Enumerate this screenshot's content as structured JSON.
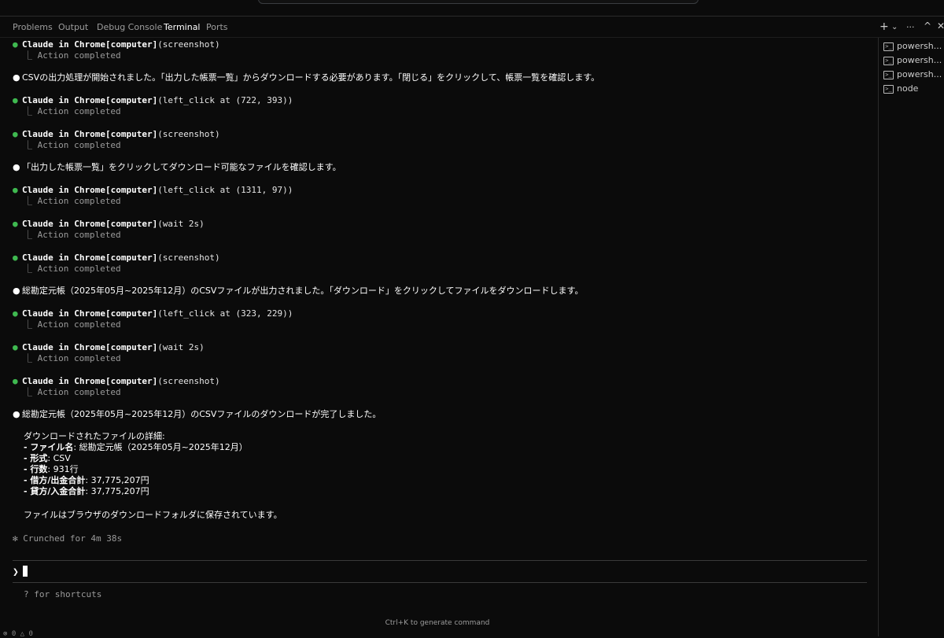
{
  "panel": {
    "tabs": [
      {
        "label": "Problems"
      },
      {
        "label": "Output"
      },
      {
        "label": "Debug Console"
      },
      {
        "label": "Terminal",
        "active": true
      },
      {
        "label": "Ports"
      }
    ],
    "actions": {
      "new": "+",
      "new_dropdown": "⌄",
      "more": "···",
      "maximize": "^",
      "close": "✕"
    }
  },
  "terminal_list": [
    {
      "label": "powersh...",
      "icon": "terminal-icon",
      "warning": "⚠"
    },
    {
      "label": "powersh...",
      "icon": "terminal-icon",
      "warning": "⚠"
    },
    {
      "label": "powersh...",
      "icon": "terminal-icon",
      "warning": "⚠"
    },
    {
      "label": "node",
      "icon": "terminal-icon"
    }
  ],
  "log": {
    "l1": {
      "cmd": "Claude in Chrome[computer]",
      "arg": "(screenshot)",
      "result": "⎿ Action completed"
    },
    "m1": "CSVの出力処理が開始されました。「出力した帳票一覧」からダウンロードする必要があります。「閉じる」をクリックして、帳票一覧を確認します。",
    "l2": {
      "cmd": "Claude in Chrome[computer]",
      "arg": "(left_click at (722, 393))",
      "result": "⎿ Action completed"
    },
    "l3": {
      "cmd": "Claude in Chrome[computer]",
      "arg": "(screenshot)",
      "result": "⎿ Action completed"
    },
    "m2": "「出力した帳票一覧」をクリックしてダウンロード可能なファイルを確認します。",
    "l4": {
      "cmd": "Claude in Chrome[computer]",
      "arg": "(left_click at (1311, 97))",
      "result": "⎿ Action completed"
    },
    "l5": {
      "cmd": "Claude in Chrome[computer]",
      "arg": "(wait 2s)",
      "result": "⎿ Action completed"
    },
    "l6": {
      "cmd": "Claude in Chrome[computer]",
      "arg": "(screenshot)",
      "result": "⎿ Action completed"
    },
    "m3": "総勘定元帳（2025年05月~2025年12月）のCSVファイルが出力されました。「ダウンロード」をクリックしてファイルをダウンロードします。",
    "l7": {
      "cmd": "Claude in Chrome[computer]",
      "arg": "(left_click at (323, 229))",
      "result": "⎿ Action completed"
    },
    "l8": {
      "cmd": "Claude in Chrome[computer]",
      "arg": "(wait 2s)",
      "result": "⎿ Action completed"
    },
    "l9": {
      "cmd": "Claude in Chrome[computer]",
      "arg": "(screenshot)",
      "result": "⎿ Action completed"
    },
    "m4": "総勘定元帳（2025年05月~2025年12月）のCSVファイルのダウンロードが完了しました。",
    "details_heading": "ダウンロードされたファイルの詳細:",
    "details": [
      {
        "key": "- ファイル名",
        "value": ": 総勘定元帳（2025年05月~2025年12月）"
      },
      {
        "key": "- 形式",
        "value": ": CSV"
      },
      {
        "key": "- 行数",
        "value": ": 931行"
      },
      {
        "key": "- 借方/出金合計",
        "value": ": 37,775,207円"
      },
      {
        "key": "- 貸方/入金合計",
        "value": ": 37,775,207円"
      }
    ],
    "footer_msg": "ファイルはブラウザのダウンロードフォルダに保存されています。",
    "crunched": "✻ Crunched for 4m 38s"
  },
  "prompt": {
    "chevron": "❯",
    "hint": "? for shortcuts"
  },
  "generate_hint": "Ctrl+K to generate command",
  "bottom_glyph": "⊗ 0 △ 0",
  "colors": {
    "bullet_tool": "#3fb950",
    "bullet_msg": "#ffffff",
    "background": "#0b0b0b"
  }
}
